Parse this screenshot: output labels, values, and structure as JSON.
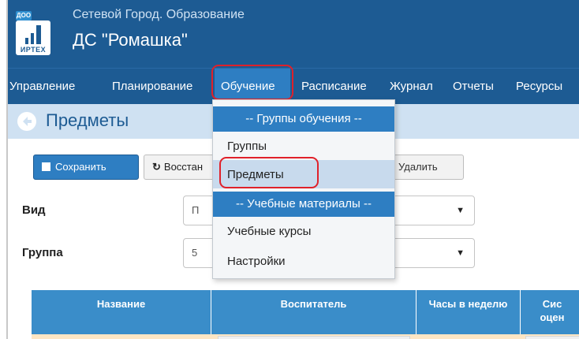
{
  "header": {
    "logo_badge": "ДОО",
    "logo_text": "ИРТЕХ",
    "app_title": "Сетевой Город. Образование",
    "org_name": "ДС \"Ромашка\""
  },
  "nav": {
    "items": [
      {
        "label": "Управление"
      },
      {
        "label": "Планирование"
      },
      {
        "label": "Обучение"
      },
      {
        "label": "Расписание"
      },
      {
        "label": "Журнал"
      },
      {
        "label": "Отчеты"
      },
      {
        "label": "Ресурсы"
      }
    ],
    "active": "Обучение"
  },
  "page": {
    "title": "Предметы"
  },
  "toolbar": {
    "save_label": "Сохранить",
    "restore_label": "Восстан",
    "delete_label": "Удалить"
  },
  "form": {
    "vid_label": "Вид",
    "vid_value": "П",
    "group_label": "Группа",
    "group_value": "5"
  },
  "table": {
    "headers": [
      {
        "label": "Название"
      },
      {
        "label": "Воспитатель"
      },
      {
        "label": "Часы в неделю"
      },
      {
        "label": "Сис\nоцен"
      }
    ]
  },
  "dropdown": {
    "section1_header": "-- Группы обучения --",
    "item_groups": "Группы",
    "item_subjects": "Предметы",
    "section2_header": "-- Учебные материалы --",
    "item_courses": "Учебные курсы",
    "item_settings": "Настройки"
  },
  "colors": {
    "header_bg": "#1d5b93",
    "active_nav": "#2e7ec2",
    "highlight": "#e0212a",
    "table_header": "#3a8dc9"
  }
}
